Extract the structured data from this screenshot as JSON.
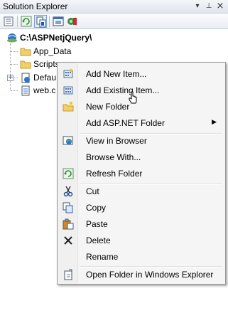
{
  "window": {
    "title": "Solution Explorer",
    "pin_glyph": "▾",
    "autohide_glyph": "⊥",
    "close_glyph": "×"
  },
  "toolbar": {
    "buttons": [
      "properties-icon",
      "refresh-icon",
      "show-all-files-icon",
      "view-designer-icon",
      "asp-net-configuration-icon"
    ]
  },
  "tree": {
    "root": {
      "label": "C:\\ASPNetjQuery\\",
      "icon": "website-icon"
    },
    "items": [
      {
        "label": "App_Data",
        "icon": "folder-icon"
      },
      {
        "label": "Scripts",
        "icon": "folder-icon"
      },
      {
        "label": "Defau",
        "icon": "web-page-icon",
        "expander": "+"
      },
      {
        "label": "web.c",
        "icon": "config-file-icon"
      }
    ]
  },
  "context_menu": {
    "groups": [
      [
        {
          "label": "Add New Item...",
          "icon": "add-new-item-icon"
        },
        {
          "label": "Add Existing Item...",
          "icon": "add-existing-item-icon"
        },
        {
          "label": "New Folder",
          "icon": "new-folder-icon"
        },
        {
          "label": "Add ASP.NET Folder",
          "icon": "",
          "submenu": "▶"
        }
      ],
      [
        {
          "label": "View in Browser",
          "icon": "view-in-browser-icon"
        },
        {
          "label": "Browse With...",
          "icon": ""
        },
        {
          "label": "Refresh Folder",
          "icon": "refresh-icon"
        }
      ],
      [
        {
          "label": "Cut",
          "icon": "cut-icon"
        },
        {
          "label": "Copy",
          "icon": "copy-icon"
        },
        {
          "label": "Paste",
          "icon": "paste-icon"
        },
        {
          "label": "Delete",
          "icon": "delete-icon"
        },
        {
          "label": "Rename",
          "icon": ""
        }
      ],
      [
        {
          "label": "Open Folder in Windows Explorer",
          "icon": "open-folder-icon"
        }
      ]
    ]
  },
  "colors": {
    "menu_bg": "#f5f5f5",
    "menu_border": "#979797",
    "pressed_border": "#7da2ce",
    "folder": "#f2cf6b"
  }
}
